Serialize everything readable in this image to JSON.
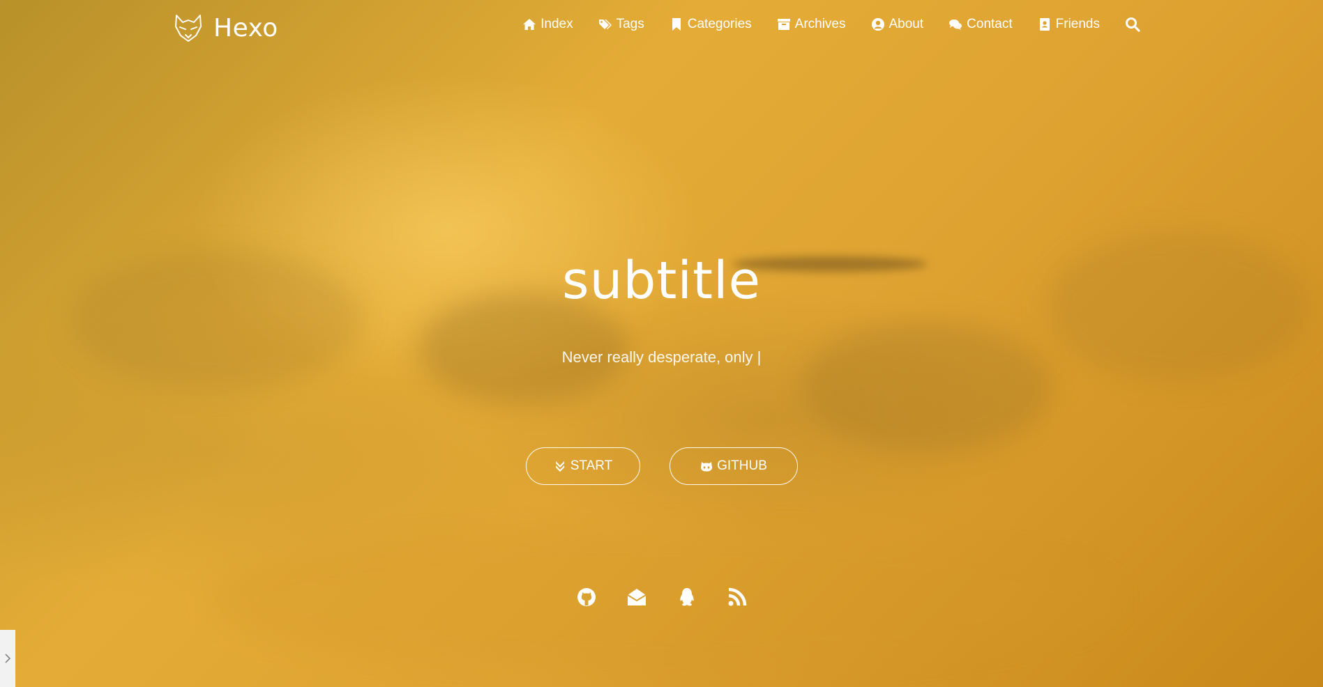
{
  "brand": {
    "name": "Hexo"
  },
  "nav": {
    "items": [
      {
        "label": "Index",
        "icon": "home-icon"
      },
      {
        "label": "Tags",
        "icon": "tags-icon"
      },
      {
        "label": "Categories",
        "icon": "bookmark-icon"
      },
      {
        "label": "Archives",
        "icon": "archive-icon"
      },
      {
        "label": "About",
        "icon": "user-circle-icon"
      },
      {
        "label": "Contact",
        "icon": "comments-icon"
      },
      {
        "label": "Friends",
        "icon": "address-book-icon"
      }
    ],
    "search_icon": "search-icon"
  },
  "hero": {
    "title": "subtitle",
    "slogan": "Never really desperate, only |",
    "buttons": {
      "start_label": "START",
      "start_icon": "angle-double-down-icon",
      "github_label": "GITHUB",
      "github_icon": "github-alt-icon"
    }
  },
  "socials": [
    "github-icon",
    "envelope-open-icon",
    "qq-icon",
    "rss-icon"
  ],
  "side_toggle_icon": "chevron-right-icon",
  "colors": {
    "text": "#ffffff",
    "background_accent": "#dea231"
  }
}
